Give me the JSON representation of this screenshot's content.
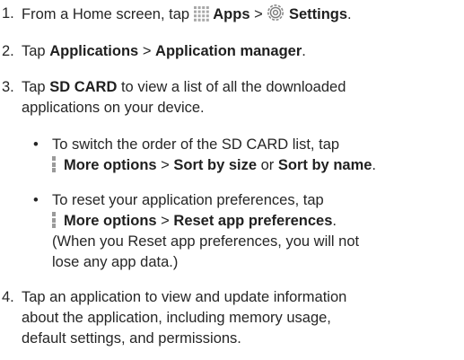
{
  "step1": {
    "number": "1.",
    "lead": "From a Home screen, tap",
    "apps_icon": "apps-grid-icon",
    "apps_label": "Apps",
    "sep": ">",
    "settings_icon": "settings-gear-icon",
    "settings_label": "Settings",
    "end": "."
  },
  "step2": {
    "number": "2.",
    "lead": "Tap",
    "applications_label": "Applications",
    "sep": ">",
    "manager_label": "Application manager",
    "end": "."
  },
  "step3": {
    "number": "3.",
    "lead": "Tap",
    "sdcard_label": "SD CARD",
    "line1_rest": "to view a list of all the downloaded",
    "line2": "applications on your device."
  },
  "bullet1": {
    "dot": "•",
    "line1": "To switch the order of the SD CARD list, tap",
    "more_icon": "more-options-icon",
    "more_label": "More options",
    "sep": ">",
    "size_label": "Sort by size",
    "or": "or",
    "name_label": "Sort by name",
    "end": "."
  },
  "bullet2": {
    "dot": "•",
    "line1": "To reset your application preferences, tap",
    "more_icon": "more-options-icon",
    "more_label": "More options",
    "sep": ">",
    "reset_label": "Reset app preferences",
    "end": ".",
    "line3": "(When you Reset app preferences, you will not",
    "line4": "lose any app data.)"
  },
  "step4": {
    "number": "4.",
    "line1": "Tap an application to view and update information",
    "line2": "about the application, including memory usage,",
    "line3": "default settings, and permissions."
  }
}
